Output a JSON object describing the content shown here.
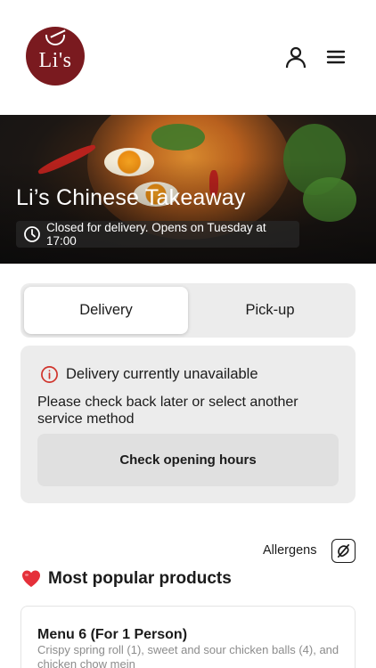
{
  "header": {
    "logo_text": "Li's",
    "icons": {
      "account": "user-icon",
      "menu": "hamburger-menu-icon"
    }
  },
  "hero": {
    "title": "Li’s Chinese Takeaway",
    "status": "Closed for delivery. Opens on Tuesday at 17:00",
    "status_icon": "clock-icon"
  },
  "service": {
    "options": [
      {
        "label": "Delivery",
        "selected": true
      },
      {
        "label": "Pick-up",
        "selected": false
      }
    ]
  },
  "unavailable": {
    "icon": "info-circle-icon",
    "icon_color": "#d0342c",
    "title": "Delivery currently unavailable",
    "message": "Please check back later or select another service method",
    "button_label": "Check opening hours"
  },
  "allergens": {
    "label": "Allergens",
    "icon": "allergen-icon"
  },
  "popular": {
    "icon": "heart-icon",
    "title": "Most popular products",
    "products": [
      {
        "name": "Menu 6 (For 1 Person)",
        "description": "Crispy spring roll (1), sweet and sour chicken balls (4), and chicken chow mein"
      }
    ]
  },
  "colors": {
    "brand": "#7a1a1f",
    "panel": "#ececec",
    "button": "#e0e0e0"
  }
}
